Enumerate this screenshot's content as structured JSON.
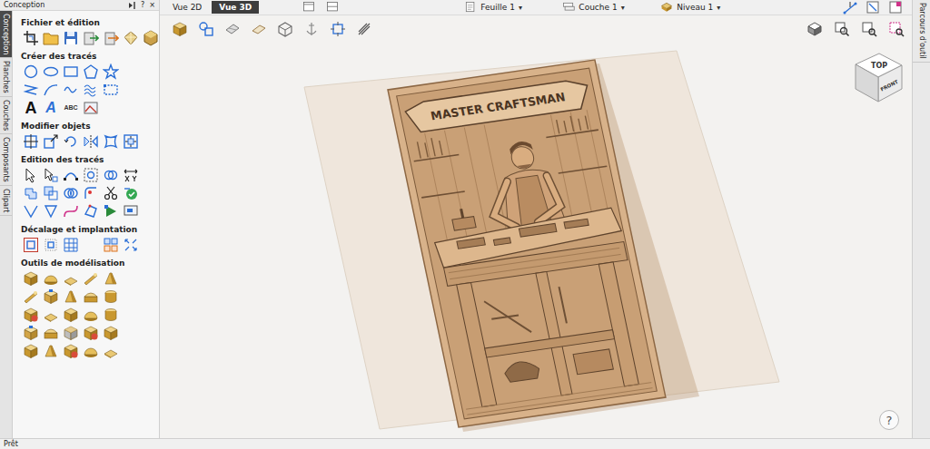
{
  "left_panel": {
    "title": "Conception",
    "buttons": [
      "?",
      "×"
    ],
    "side_tabs": [
      {
        "label": "Conception",
        "selected": true
      },
      {
        "label": "Planches",
        "selected": false
      },
      {
        "label": "Couches",
        "selected": false
      },
      {
        "label": "Composants",
        "selected": false
      },
      {
        "label": "Clipart",
        "selected": false
      }
    ],
    "sections": [
      {
        "title": "Fichier et édition"
      },
      {
        "title": "Créer des tracés"
      },
      {
        "title": "Modifier objets"
      },
      {
        "title": "Edition des tracés"
      },
      {
        "title": "Décalage et implantation"
      },
      {
        "title": "Outils de modélisation"
      }
    ],
    "text_tools": [
      "A",
      "A",
      "ABC"
    ]
  },
  "view_tabs": [
    {
      "label": "Vue 2D",
      "selected": false
    },
    {
      "label": "Vue 3D",
      "selected": true
    }
  ],
  "dropdowns": [
    {
      "label": "Feuille 1",
      "caret": "▾"
    },
    {
      "label": "Couche 1",
      "caret": "▾"
    },
    {
      "label": "Niveau 1",
      "caret": "▾"
    }
  ],
  "right_tab": {
    "label": "Parcours d'outil"
  },
  "viewcube": {
    "top": "TOP",
    "front": "FRONT"
  },
  "relief": {
    "banner": "MASTER CRAFTSMAN"
  },
  "help_button": "?",
  "status_bar": "Prêt"
}
